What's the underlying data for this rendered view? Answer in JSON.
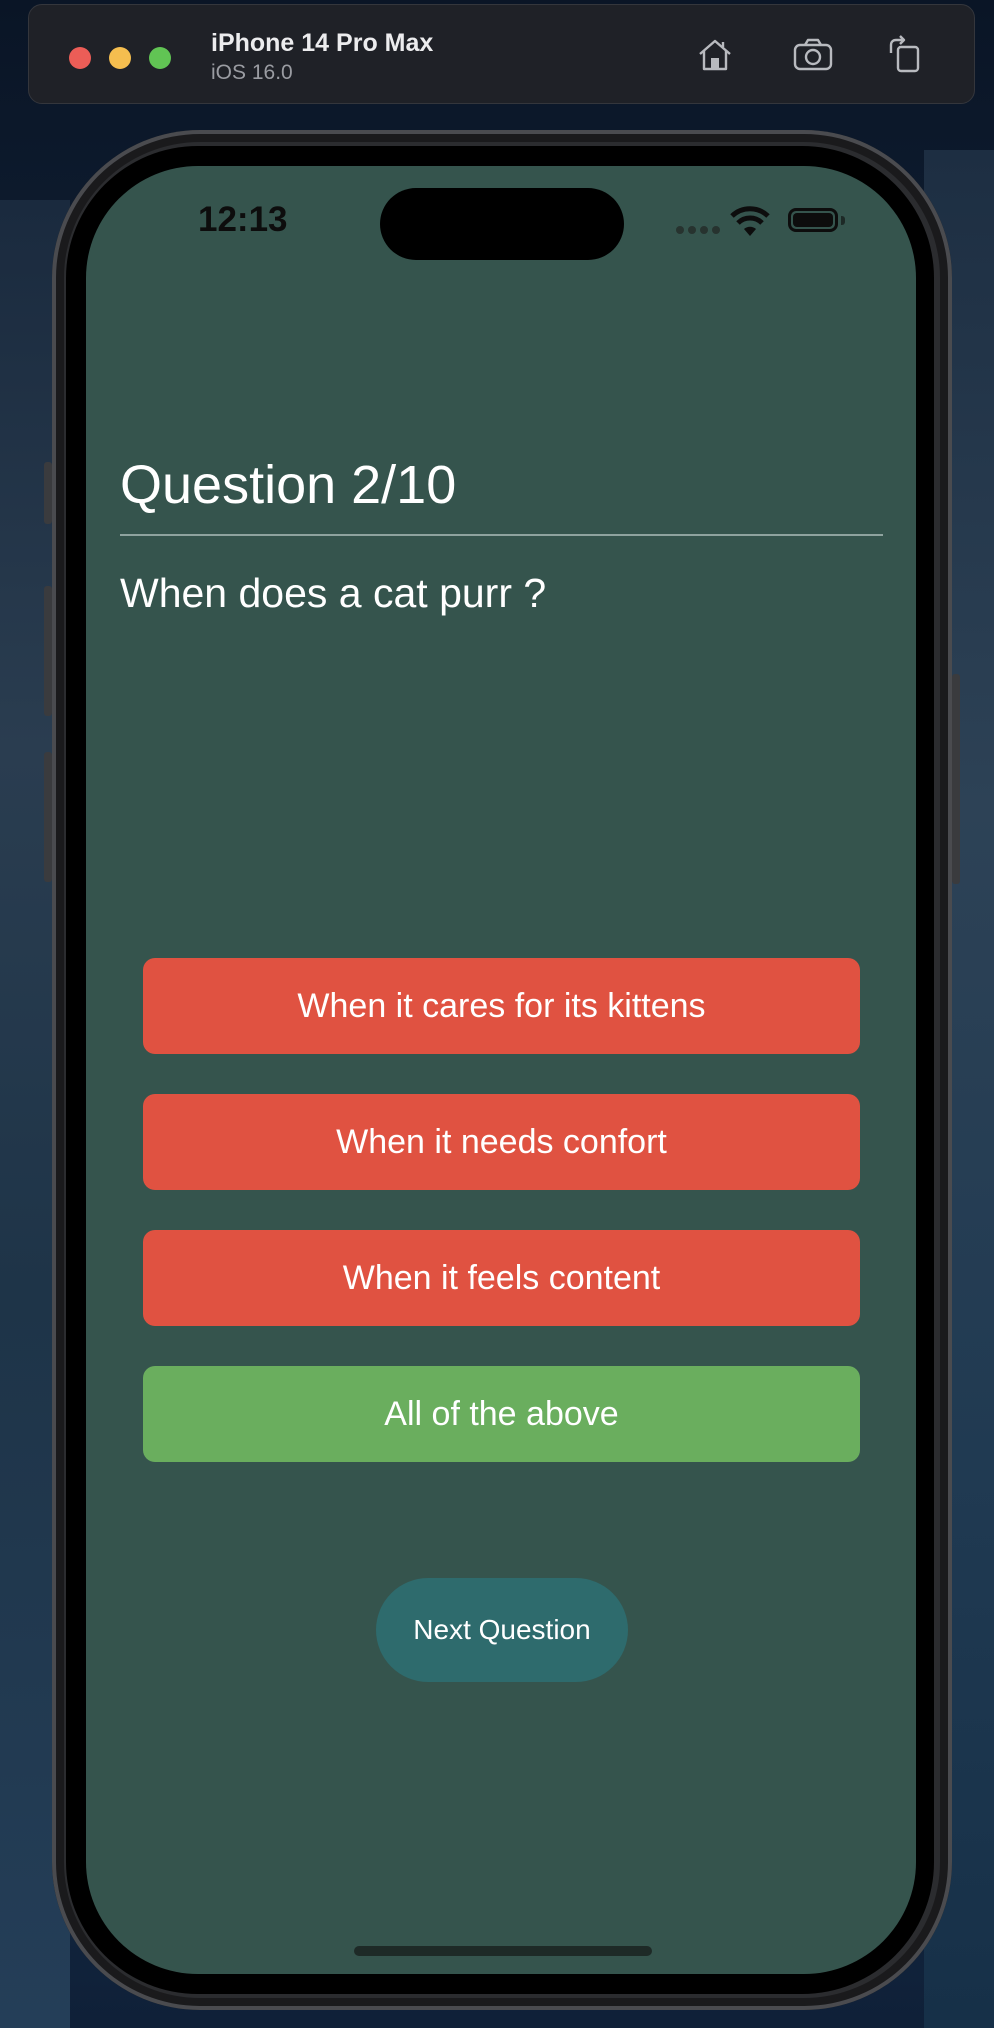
{
  "simulator": {
    "device_name": "iPhone 14 Pro Max",
    "os_version": "iOS 16.0",
    "icons": [
      "home-icon",
      "screenshot-icon",
      "rotate-icon"
    ]
  },
  "status_bar": {
    "time": "12:13"
  },
  "quiz": {
    "title": "Question 2/10",
    "question": "When does a cat purr ?",
    "answers": [
      {
        "label": "When it cares for its kittens",
        "state": "wrong"
      },
      {
        "label": "When it needs confort",
        "state": "wrong"
      },
      {
        "label": "When it feels content",
        "state": "wrong"
      },
      {
        "label": "All of the above",
        "state": "correct"
      }
    ],
    "next_label": "Next Question"
  },
  "colors": {
    "background": "#35544d",
    "wrong": "#e05241",
    "correct": "#6aae5e",
    "next_button": "#2e6b6d"
  }
}
